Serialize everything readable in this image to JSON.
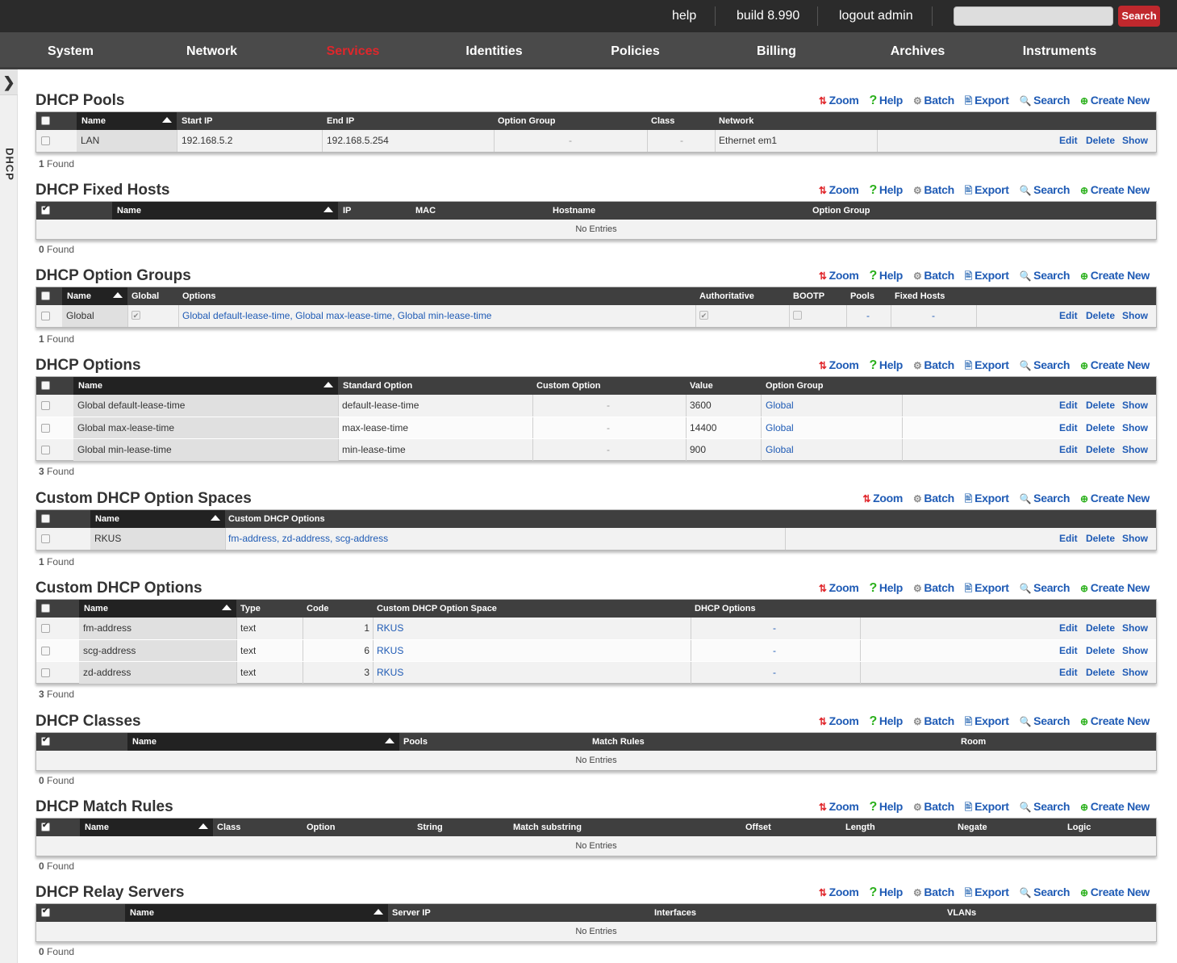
{
  "topbar": {
    "help": "help",
    "build": "build 8.990",
    "logout": "logout admin",
    "search_placeholder": "",
    "search_button": "Search"
  },
  "nav": [
    "System",
    "Network",
    "Services",
    "Identities",
    "Policies",
    "Billing",
    "Archives",
    "Instruments"
  ],
  "nav_active": "Services",
  "sidebar": {
    "label": "DHCP"
  },
  "actions": {
    "zoom": "Zoom",
    "help": "Help",
    "batch": "Batch",
    "export": "Export",
    "search": "Search",
    "create": "Create New"
  },
  "row_actions": {
    "edit": "Edit",
    "delete": "Delete",
    "show": "Show"
  },
  "no_entries": "No Entries",
  "colors": {
    "topbar": "#2b2b2b",
    "nav": "#4a4a4a",
    "active": "#e0262b",
    "link": "#1f5bb5",
    "header": "#3f3f3f"
  },
  "sections": {
    "pools": {
      "title": "DHCP Pools",
      "found": "Found",
      "count": "1",
      "columns": [
        "Name",
        "Start IP",
        "End IP",
        "Option Group",
        "Class",
        "Network"
      ],
      "rows": [
        [
          "LAN",
          "192.168.5.2",
          "192.168.5.254",
          "-",
          "-",
          "Ethernet em1"
        ]
      ]
    },
    "fixed_hosts": {
      "title": "DHCP Fixed Hosts",
      "found": "Found",
      "count": "0",
      "columns": [
        "Name",
        "IP",
        "MAC",
        "Hostname",
        "Option Group"
      ]
    },
    "option_groups": {
      "title": "DHCP Option Groups",
      "found": "Found",
      "count": "1",
      "columns": [
        "Name",
        "Global",
        "Options",
        "Authoritative",
        "BOOTP",
        "Pools",
        "Fixed Hosts"
      ],
      "rows": [
        [
          "Global",
          "Global default-lease-time, Global max-lease-time, Global min-lease-time",
          "-",
          "-"
        ]
      ]
    },
    "options": {
      "title": "DHCP Options",
      "found": "Found",
      "count": "3",
      "columns": [
        "Name",
        "Standard Option",
        "Custom Option",
        "Value",
        "Option Group"
      ],
      "rows": [
        [
          "Global default-lease-time",
          "default-lease-time",
          "-",
          "3600",
          "Global"
        ],
        [
          "Global max-lease-time",
          "max-lease-time",
          "-",
          "14400",
          "Global"
        ],
        [
          "Global min-lease-time",
          "min-lease-time",
          "-",
          "900",
          "Global"
        ]
      ]
    },
    "option_spaces": {
      "title": "Custom DHCP Option Spaces",
      "found": "Found",
      "count": "1",
      "columns": [
        "Name",
        "Custom DHCP Options"
      ],
      "rows": [
        [
          "RKUS",
          "fm-address, zd-address, scg-address"
        ]
      ]
    },
    "custom_options": {
      "title": "Custom DHCP Options",
      "found": "Found",
      "count": "3",
      "columns": [
        "Name",
        "Type",
        "Code",
        "Custom DHCP Option Space",
        "DHCP Options"
      ],
      "rows": [
        [
          "fm-address",
          "text",
          "1",
          "RKUS",
          "-"
        ],
        [
          "scg-address",
          "text",
          "6",
          "RKUS",
          "-"
        ],
        [
          "zd-address",
          "text",
          "3",
          "RKUS",
          "-"
        ]
      ]
    },
    "classes": {
      "title": "DHCP Classes",
      "found": "Found",
      "count": "0",
      "columns": [
        "Name",
        "Pools",
        "Match Rules",
        "Room"
      ]
    },
    "match_rules": {
      "title": "DHCP Match Rules",
      "found": "Found",
      "count": "0",
      "columns": [
        "Name",
        "Class",
        "Option",
        "String",
        "Match substring",
        "Offset",
        "Length",
        "Negate",
        "Logic"
      ]
    },
    "relay_servers": {
      "title": "DHCP Relay Servers",
      "found": "Found",
      "count": "0",
      "columns": [
        "Name",
        "Server IP",
        "Interfaces",
        "VLANs"
      ]
    }
  }
}
